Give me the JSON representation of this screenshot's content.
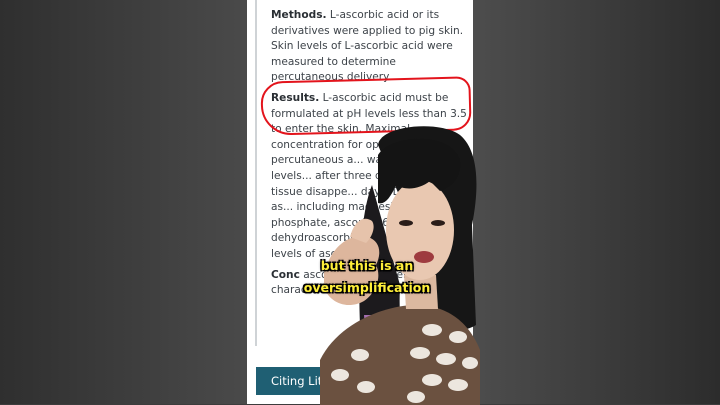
{
  "article": {
    "methods": {
      "heading": "Methods.",
      "text": "L-ascorbic acid or its derivatives were applied to pig skin. Skin levels of L-ascorbic acid were measured to determine percutaneous delivery."
    },
    "results": {
      "heading": "Results.",
      "text": "L-ascorbic acid must be formulated at pH levels less than 3.5 to enter the skin. Maximal concentration for optimal percutaneous a... was 20%. Tissue levels... after three daily appl... life of tissue disappe... days. Derivatives of as... including magnesium a... phosphate, ascorbyl-6-p... dehydroascorbic acid did... skin levels of ascorbic..."
    },
    "conclusions": {
      "heading": "Conc",
      "text": "ascorbic ac... dependent... characteris..."
    }
  },
  "citing_button": {
    "label": "Citing Lite"
  },
  "caption": {
    "line1": "but this is an",
    "line2": "oversimplification"
  },
  "colors": {
    "highlight_circle": "#e3141c",
    "caption_text": "#ffef3a",
    "citing_bar": "#1f5f73"
  }
}
